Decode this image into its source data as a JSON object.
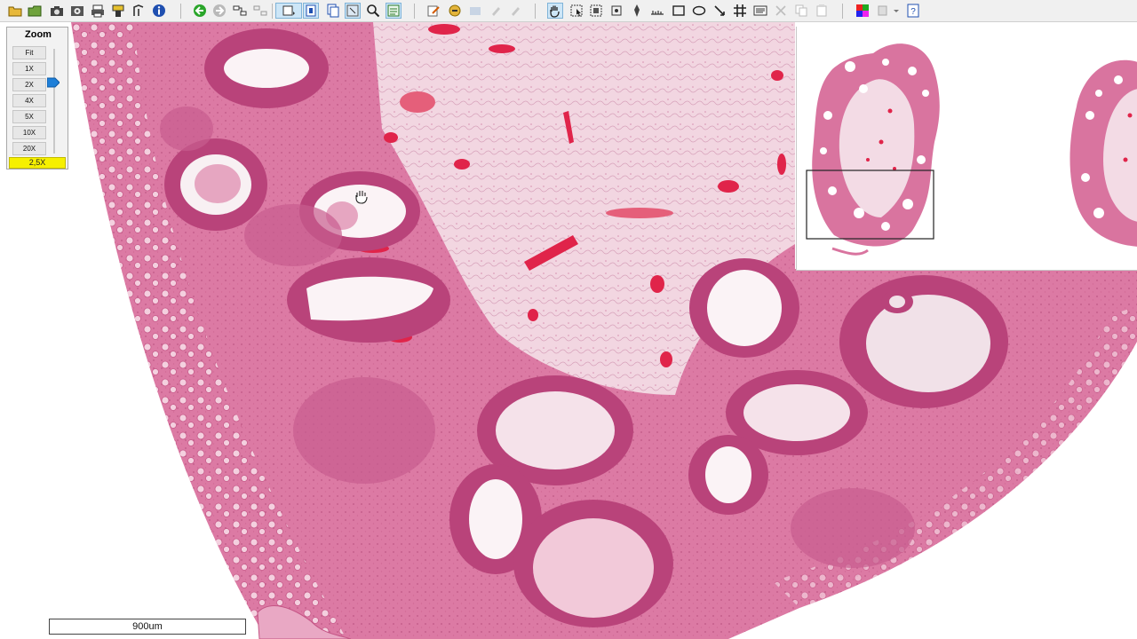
{
  "toolbar": {
    "icons": [
      "open-folder-icon",
      "save-icon",
      "camera-icon",
      "snapshot-icon",
      "print-icon",
      "tools-icon",
      "settings-icon",
      "info-icon",
      "back-icon",
      "forward-icon",
      "link-icon",
      "export-icon",
      "select-region-icon",
      "rectangle-select-icon",
      "report-icon",
      "annotation-icon",
      "zoom-icon",
      "grid-view-icon",
      "pen-icon",
      "highlight-icon",
      "undo-icon",
      "redo-icon",
      "pan-hand-icon",
      "pointer-icon",
      "crop-icon",
      "marker-icon",
      "measure-ruler-icon",
      "rectangle-icon",
      "ellipse-icon",
      "arrow-icon",
      "grid-icon",
      "text-box-icon",
      "scissors-icon",
      "copy-icon",
      "paste-icon",
      "color-picker-icon",
      "layout-icon",
      "help-icon"
    ]
  },
  "zoom": {
    "title": "Zoom",
    "levels": [
      "Fit",
      "1X",
      "2X",
      "4X",
      "5X",
      "10X",
      "20X"
    ],
    "current": "2,5X"
  },
  "scale_bar": {
    "label": "900um"
  },
  "colors": {
    "tissue": "#d9749f",
    "tissue_dark": "#b9437a",
    "stroma": "#efd0dc",
    "vessel": "#e0244a",
    "lumen": "#fbf3f6",
    "highlight": "#f6f000"
  }
}
